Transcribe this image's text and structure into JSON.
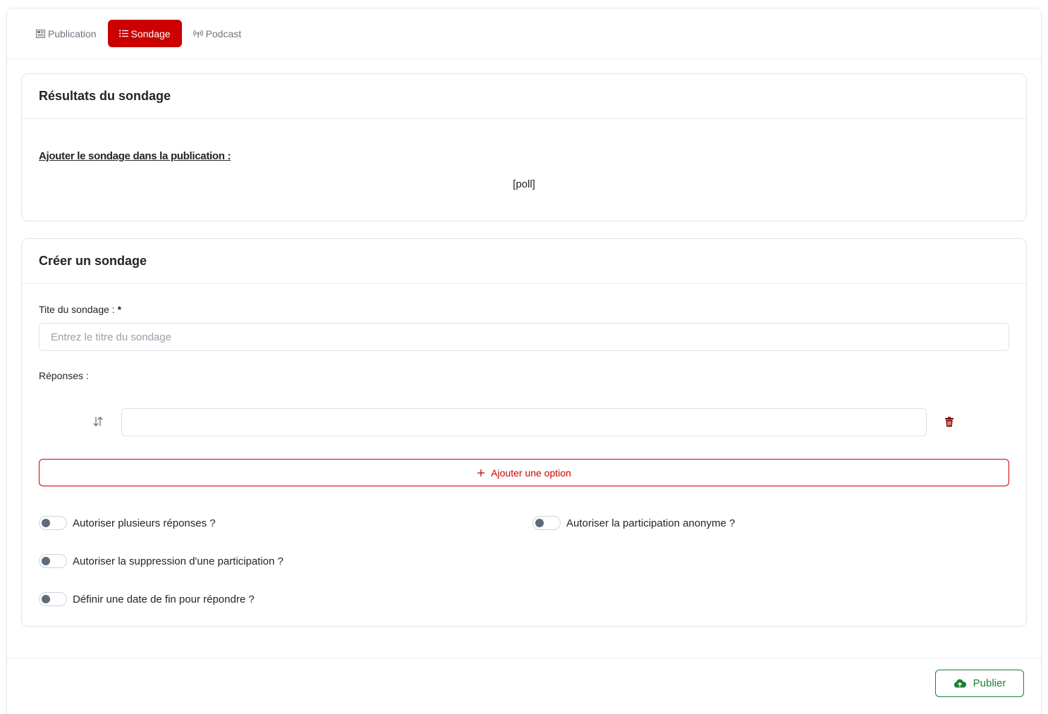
{
  "tabs": [
    {
      "label": "Publication",
      "icon": "newspaper-icon",
      "active": false
    },
    {
      "label": "Sondage",
      "icon": "list-icon",
      "active": true
    },
    {
      "label": "Podcast",
      "icon": "broadcast-icon",
      "active": false
    }
  ],
  "results": {
    "title": "Résultats du sondage",
    "embed_label": "Ajouter le sondage dans la publication :",
    "shortcode": "[poll]"
  },
  "create": {
    "title": "Créer un sondage",
    "poll_title_label": "Tite du sondage :",
    "required_mark": "*",
    "poll_title_placeholder": "Entrez le titre du sondage",
    "poll_title_value": "",
    "answers_label": "Réponses :",
    "answer_option_value": "",
    "add_option_label": "Ajouter une option",
    "toggles": [
      {
        "label": "Autoriser plusieurs réponses ?",
        "checked": false
      },
      {
        "label": "Autoriser la participation anonyme ?",
        "checked": false
      },
      {
        "label": "Autoriser la suppression d'une participation ?",
        "checked": false
      },
      {
        "label": "Définir une date de fin pour répondre ?",
        "checked": false
      }
    ]
  },
  "footer": {
    "publish_label": "Publier"
  },
  "colors": {
    "accent": "#cc0000",
    "success": "#1e7e34",
    "trash": "#8b0000",
    "toggle_knob": "#606b78"
  }
}
